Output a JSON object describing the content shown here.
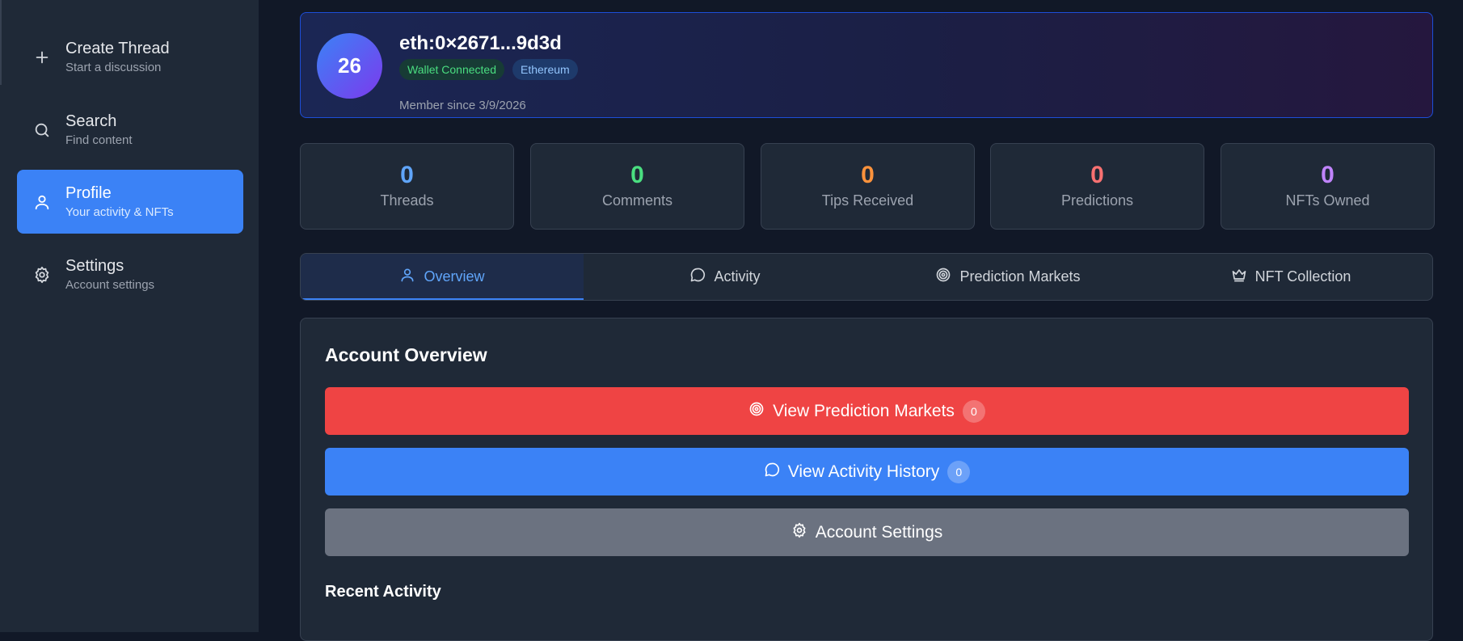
{
  "colors": {
    "threads": "#60a5fa",
    "comments": "#4ade80",
    "tips": "#fb923c",
    "predictions": "#f87171",
    "nfts": "#c084fc"
  },
  "sidebar": {
    "items": [
      {
        "title": "Create Thread",
        "subtitle": "Start a discussion",
        "icon": "plus-icon"
      },
      {
        "title": "Search",
        "subtitle": "Find content",
        "icon": "search-icon"
      },
      {
        "title": "Profile",
        "subtitle": "Your activity & NFTs",
        "icon": "user-icon",
        "active": true
      },
      {
        "title": "Settings",
        "subtitle": "Account settings",
        "icon": "gear-icon"
      }
    ]
  },
  "profile": {
    "avatar_text": "26",
    "address": "eth:0×2671...9d3d",
    "badge_wallet": "Wallet Connected",
    "badge_chain": "Ethereum",
    "member_since": "Member since 3/9/2026"
  },
  "stats": [
    {
      "value": "0",
      "label": "Threads"
    },
    {
      "value": "0",
      "label": "Comments"
    },
    {
      "value": "0",
      "label": "Tips Received"
    },
    {
      "value": "0",
      "label": "Predictions"
    },
    {
      "value": "0",
      "label": "NFTs Owned"
    }
  ],
  "tabs": [
    {
      "label": "Overview",
      "icon": "user-icon",
      "active": true
    },
    {
      "label": "Activity",
      "icon": "message-icon"
    },
    {
      "label": "Prediction Markets",
      "icon": "target-icon"
    },
    {
      "label": "NFT Collection",
      "icon": "crown-icon"
    }
  ],
  "overview": {
    "title": "Account Overview",
    "prediction_btn": "View Prediction Markets",
    "prediction_count": "0",
    "activity_btn": "View Activity History",
    "activity_count": "0",
    "settings_btn": "Account Settings",
    "recent_title": "Recent Activity"
  }
}
